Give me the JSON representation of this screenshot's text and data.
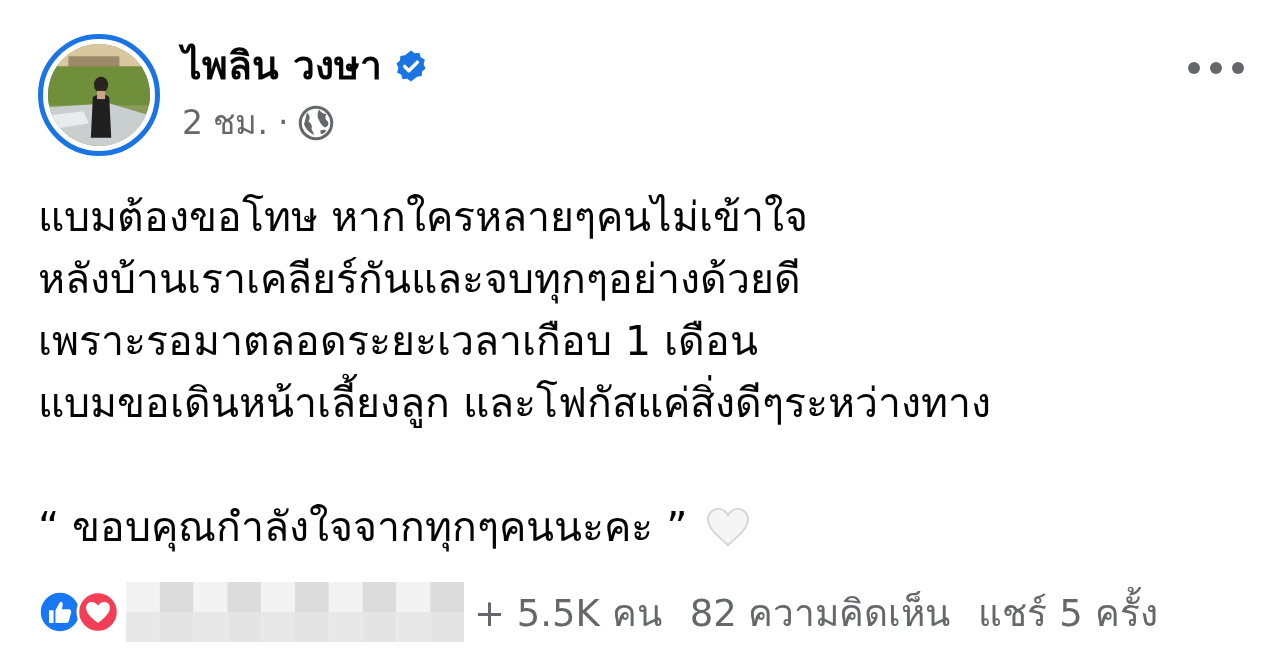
{
  "post": {
    "author": "ไพลิน วงษา",
    "verified": true,
    "time": "2 ชม.",
    "separator": "·",
    "lines": [
      "แบมต้องขอโทษ หากใครหลายๆคนไม่เข้าใจ",
      "หลังบ้านเราเคลียร์กันและจบทุกๆอย่างด้วยดี",
      "เพราะรอมาตลอดระยะเวลาเกือบ 1 เดือน",
      "แบมขอเดินหน้าเลี้ยงลูก และโฟกัสแค่สิ่งดีๆระหว่างทาง"
    ],
    "quote": "“ ขอบคุณกำลังใจจากทุกๆคนนะคะ  ”"
  },
  "footer": {
    "reaction_count": "+ 5.5K คน",
    "comments": "82 ความคิดเห็น",
    "shares": "แชร์ 5 ครั้ง"
  }
}
